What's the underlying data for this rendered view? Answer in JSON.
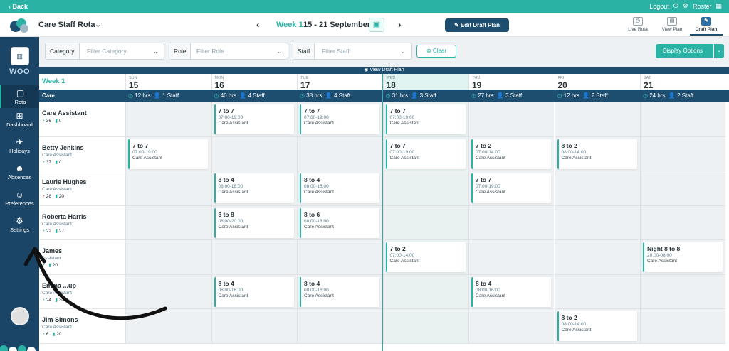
{
  "topbar": {
    "back": "‹ Back",
    "logout": "Logout",
    "roster": "Roster"
  },
  "header": {
    "title": "Care Staff Rota",
    "week_label": "Week 1",
    "week_range": "15 - 21 September",
    "edit_button": "Edit Draft Plan",
    "views": [
      {
        "label": "Live Rota"
      },
      {
        "label": "View Plan"
      },
      {
        "label": "Draft Plan"
      }
    ]
  },
  "sidebar": {
    "brand": "WOO",
    "items": [
      {
        "label": "Rota"
      },
      {
        "label": "Dashboard"
      },
      {
        "label": "Holidays"
      },
      {
        "label": "Absences"
      },
      {
        "label": "Preferences"
      },
      {
        "label": "Settings"
      }
    ]
  },
  "filters": {
    "category": {
      "label": "Category",
      "placeholder": "Filter Category"
    },
    "role": {
      "label": "Role",
      "placeholder": "Filter Role"
    },
    "staff": {
      "label": "Staff",
      "placeholder": "Filter Staff"
    },
    "clear": "Clear",
    "display_options": "Display Options"
  },
  "grid": {
    "banner": "View Draft Plan",
    "week_label": "Week 1",
    "days": [
      {
        "name": "SUN",
        "date": "15"
      },
      {
        "name": "MON",
        "date": "16"
      },
      {
        "name": "TUE",
        "date": "17"
      },
      {
        "name": "WED",
        "date": "18"
      },
      {
        "name": "THU",
        "date": "19"
      },
      {
        "name": "FRI",
        "date": "20"
      },
      {
        "name": "SAT",
        "date": "21"
      }
    ],
    "team": "Care",
    "day_stats": [
      {
        "hrs": "12 hrs",
        "staff": "1 Staff"
      },
      {
        "hrs": "40 hrs",
        "staff": "4 Staff"
      },
      {
        "hrs": "38 hrs",
        "staff": "4 Staff"
      },
      {
        "hrs": "31 hrs",
        "staff": "3 Staff"
      },
      {
        "hrs": "27 hrs",
        "staff": "3 Staff"
      },
      {
        "hrs": "12 hrs",
        "staff": "2 Staff"
      },
      {
        "hrs": "24 hrs",
        "staff": "2 Staff"
      }
    ],
    "employees": [
      {
        "name": "Care Assistant",
        "role": "",
        "a": "36",
        "b": "0"
      },
      {
        "name": "Betty Jenkins",
        "role": "Care Assistant",
        "a": "37",
        "b": "0"
      },
      {
        "name": "Laurie Hughes",
        "role": "Care Assistant",
        "a": "28",
        "b": "20"
      },
      {
        "name": "Roberta Harris",
        "role": "Care Assistant",
        "a": "22",
        "b": "27"
      },
      {
        "name": "James",
        "role": "Assistant",
        "a": "",
        "b": "20"
      },
      {
        "name": "Emma ...up",
        "role": "Care Assistant",
        "a": "24",
        "b": "30"
      },
      {
        "name": "Jim Simons",
        "role": "Care Assistant",
        "a": "6",
        "b": "20"
      }
    ],
    "shifts": [
      {
        "row": 0,
        "day": 1,
        "name": "7 to 7",
        "time": "07:00-19:00",
        "role": "Care Assistant"
      },
      {
        "row": 0,
        "day": 2,
        "name": "7 to 7",
        "time": "07:00-19:00",
        "role": "Care Assistant"
      },
      {
        "row": 0,
        "day": 3,
        "name": "7 to 7",
        "time": "07:00-19:00",
        "role": "Care Assistant"
      },
      {
        "row": 1,
        "day": 0,
        "name": "7 to 7",
        "time": "07:00-19:00",
        "role": "Care Assistant"
      },
      {
        "row": 1,
        "day": 3,
        "name": "7 to 7",
        "time": "07:00-19:00",
        "role": "Care Assistant"
      },
      {
        "row": 1,
        "day": 4,
        "name": "7 to 2",
        "time": "07:00-14:00",
        "role": "Care Assistant"
      },
      {
        "row": 1,
        "day": 5,
        "name": "8 to 2",
        "time": "08:00-14:00",
        "role": "Care Assistant"
      },
      {
        "row": 2,
        "day": 1,
        "name": "8 to 4",
        "time": "08:00-16:00",
        "role": "Care Assistant"
      },
      {
        "row": 2,
        "day": 2,
        "name": "8 to 4",
        "time": "08:00-16:00",
        "role": "Care Assistant"
      },
      {
        "row": 2,
        "day": 4,
        "name": "7 to 7",
        "time": "07:00-19:00",
        "role": "Care Assistant"
      },
      {
        "row": 3,
        "day": 1,
        "name": "8 to 8",
        "time": "08:00-20:00",
        "role": "Care Assistant"
      },
      {
        "row": 3,
        "day": 2,
        "name": "8 to 6",
        "time": "08:00-18:00",
        "role": "Care Assistant"
      },
      {
        "row": 4,
        "day": 3,
        "name": "7 to 2",
        "time": "07:00-14:00",
        "role": "Care Assistant"
      },
      {
        "row": 4,
        "day": 6,
        "name": "Night 8 to 8",
        "time": "20:00-08:00",
        "role": "Care Assistant"
      },
      {
        "row": 5,
        "day": 1,
        "name": "8 to 4",
        "time": "08:00-16:00",
        "role": "Care Assistant"
      },
      {
        "row": 5,
        "day": 2,
        "name": "8 to 4",
        "time": "08:00-16:00",
        "role": "Care Assistant"
      },
      {
        "row": 5,
        "day": 4,
        "name": "8 to 4",
        "time": "08:00-16:00",
        "role": "Care Assistant"
      },
      {
        "row": 6,
        "day": 5,
        "name": "8 to 2",
        "time": "08:00-14:00",
        "role": "Care Assistant"
      }
    ]
  },
  "colors": {
    "accent": "#2ab3a5",
    "navy": "#1d4e70",
    "sidebar": "#1a4566"
  }
}
